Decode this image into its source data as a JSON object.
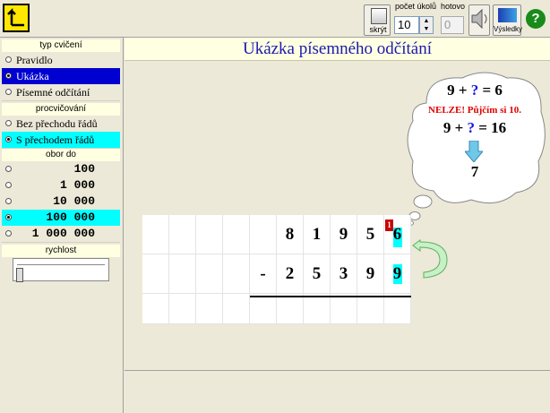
{
  "toolbar": {
    "hide_label": "skrýt",
    "count_label": "počet úkolů",
    "count_value": "10",
    "done_label": "hotovo",
    "done_value": "0",
    "results_label": "Výsledky",
    "help_label": "?",
    "stepper_up": "▲",
    "stepper_down": "▼"
  },
  "sections": {
    "exercise_type": "typ cvičení",
    "practice": "procvičování",
    "range": "obor do",
    "speed": "rychlost"
  },
  "exercise_types": [
    "Pravidlo",
    "Ukázka",
    "Písemné odčítání"
  ],
  "practice_options": [
    "Bez přechodu řádů",
    "S přechodem řádů"
  ],
  "range_options": [
    "100",
    "1 000",
    "10 000",
    "100 000",
    "1 000 000"
  ],
  "title": "Ukázka písemného odčítání",
  "cloud": {
    "line1_a": "9 + ",
    "line1_q": "?",
    "line1_b": " = 6",
    "warning": "NELZE! Půjčím si 10.",
    "line2_a": "9 + ",
    "line2_q": "?",
    "line2_b": " = 16",
    "answer": "7"
  },
  "problem": {
    "row1": [
      "8",
      "1",
      "9",
      "5",
      "6"
    ],
    "row2": [
      "-",
      "2",
      "5",
      "3",
      "9",
      "9"
    ],
    "borrow": "1"
  },
  "colors": {
    "accent_blue": "#0000D0",
    "highlight_cyan": "#00FFFF",
    "title_blue": "#1A1AB0",
    "warning_red": "#E00000",
    "help_green": "#1A8A1A"
  }
}
